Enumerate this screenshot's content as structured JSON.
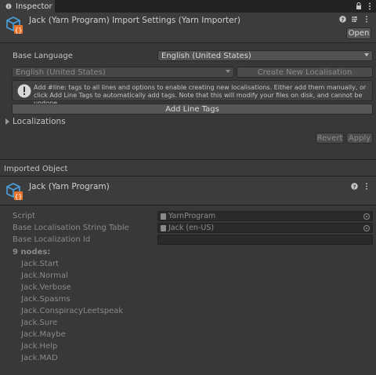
{
  "tab": {
    "label": "Inspector"
  },
  "header": {
    "title": "Jack (Yarn Program) Import Settings (Yarn Importer)",
    "open_label": "Open"
  },
  "settings": {
    "base_language_label": "Base Language",
    "base_language_value": "English (United States)",
    "localisation_dropdown_value": "English (United States)",
    "create_localisation_label": "Create New Localisation",
    "help_text": "Add #line: tags to all lines and options to enable creating new localisations. Either add them manually, or click Add Line Tags to automatically add tags. Note that this will modify your files on disk, and cannot be undone.",
    "add_line_tags_label": "Add Line Tags",
    "localizations_label": "Localizations",
    "revert_label": "Revert",
    "apply_label": "Apply"
  },
  "imported": {
    "section_label": "Imported Object",
    "title": "Jack (Yarn Program)",
    "script_label": "Script",
    "script_value": "YarnProgram",
    "string_table_label": "Base Localisation String Table",
    "string_table_value": "Jack (en-US)",
    "localization_id_label": "Base Localization Id",
    "localization_id_value": "",
    "nodes_label": "9 nodes:",
    "nodes": [
      "Jack.Start",
      "Jack.Normal",
      "Jack.Verbose",
      "Jack.Spasms",
      "Jack.ConspiracyLeetspeak",
      "Jack.Sure",
      "Jack.Maybe",
      "Jack.Help",
      "Jack.MAD"
    ]
  },
  "colors": {
    "background": "#383838",
    "header": "#3c3c3c",
    "script_icon_blue": "#4aa3df",
    "script_icon_orange": "#e8742c"
  }
}
